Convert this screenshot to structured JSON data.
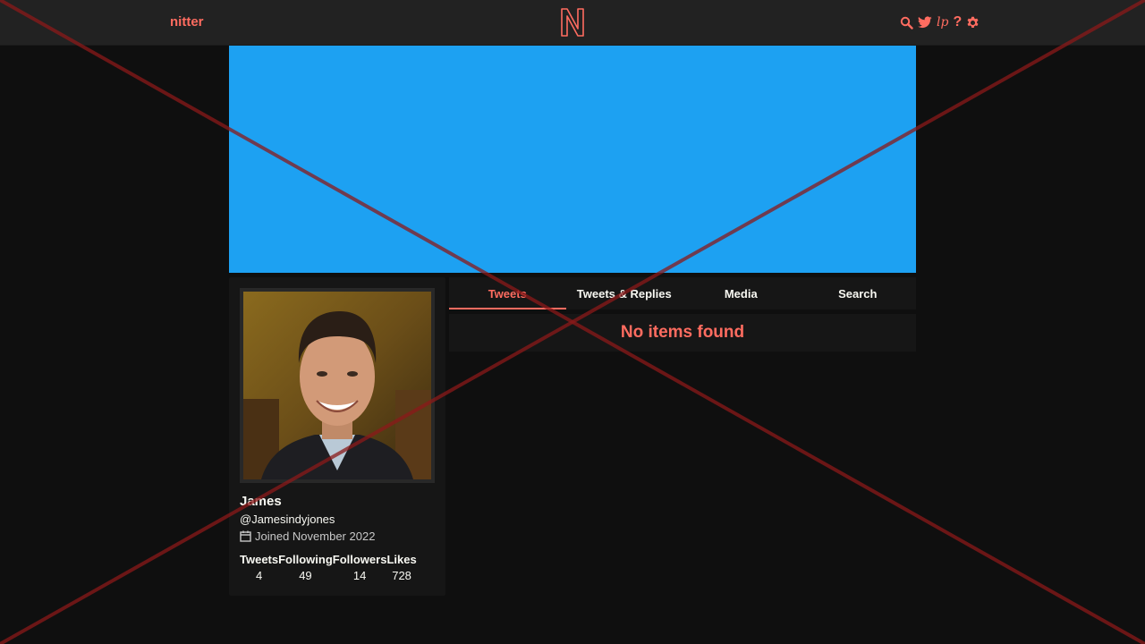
{
  "nav": {
    "brand": "nitter",
    "icons": [
      "search-icon",
      "twitter-bird-icon",
      "lp-icon",
      "help-icon",
      "gear-icon"
    ],
    "help_glyph": "?",
    "lp_glyph": "lp"
  },
  "colors": {
    "accent": "#ff6c60",
    "banner": "#1da1f2",
    "background": "#0f0f0f",
    "panel": "#161616",
    "navbar": "#222222",
    "overlay_cross": "#8b1a1a"
  },
  "profile": {
    "fullname": "James",
    "username": "@Jamesindyjones",
    "joined": "Joined November 2022",
    "stats": [
      {
        "label": "Tweets",
        "value": "4"
      },
      {
        "label": "Following",
        "value": "49"
      },
      {
        "label": "Followers",
        "value": "14"
      },
      {
        "label": "Likes",
        "value": "728"
      }
    ]
  },
  "tabs": [
    {
      "label": "Tweets",
      "active": true
    },
    {
      "label": "Tweets & Replies",
      "active": false
    },
    {
      "label": "Media",
      "active": false
    },
    {
      "label": "Search",
      "active": false
    }
  ],
  "timeline": {
    "empty_message": "No items found"
  }
}
